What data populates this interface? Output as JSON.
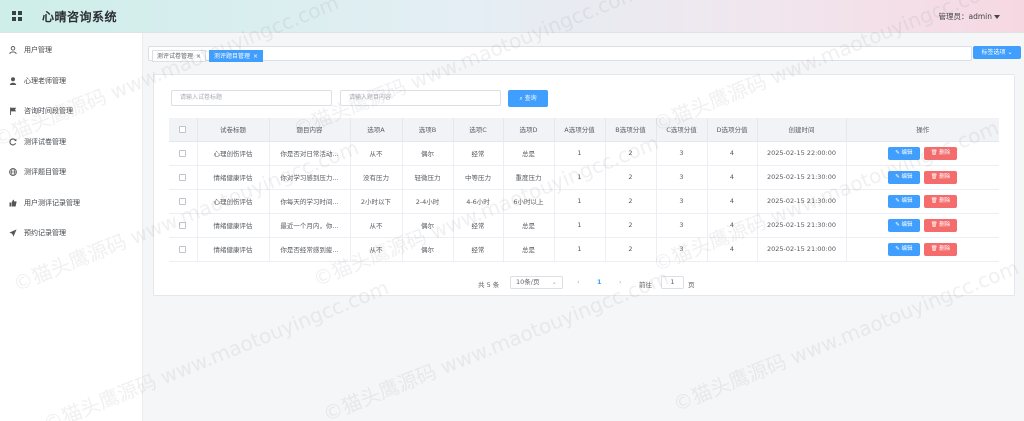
{
  "header": {
    "title": "心晴咨询系统",
    "admin_label": "管理员：admin"
  },
  "sidebar": {
    "items": [
      {
        "label": "用户管理",
        "icon": "user-icon"
      },
      {
        "label": "心理老师管理",
        "icon": "person-icon"
      },
      {
        "label": "咨询时间段管理",
        "icon": "flag-icon"
      },
      {
        "label": "测评试卷管理",
        "icon": "refresh-icon"
      },
      {
        "label": "测评题目管理",
        "icon": "globe-icon"
      },
      {
        "label": "用户测评记录管理",
        "icon": "thumb-icon"
      },
      {
        "label": "预约记录管理",
        "icon": "send-icon"
      }
    ]
  },
  "tabs": [
    {
      "label": "测评试卷管理",
      "active": false
    },
    {
      "label": "测评题目管理",
      "active": true
    }
  ],
  "tab_options_label": "标签选项",
  "filters": {
    "paper_placeholder": "请输入试卷标题",
    "content_placeholder": "请输入题目内容",
    "search_label": "查询"
  },
  "table": {
    "columns": [
      "试卷标题",
      "题目内容",
      "选项A",
      "选项B",
      "选项C",
      "选项D",
      "A选项分值",
      "B选项分值",
      "C选项分值",
      "D选项分值",
      "创建时间",
      "操作"
    ],
    "rows": [
      [
        "心理创伤评估",
        "你是否对日常活动...",
        "从不",
        "偶尔",
        "经常",
        "总是",
        "1",
        "2",
        "3",
        "4",
        "2025-02-15 22:00:00"
      ],
      [
        "情绪健康评估",
        "你对学习感到压力...",
        "没有压力",
        "轻微压力",
        "中等压力",
        "重度压力",
        "1",
        "2",
        "3",
        "4",
        "2025-02-15 21:30:00"
      ],
      [
        "心理创伤评估",
        "你每天的学习时间...",
        "2小时以下",
        "2-4小时",
        "4-6小时",
        "6小时以上",
        "1",
        "2",
        "3",
        "4",
        "2025-02-15 21:30:00"
      ],
      [
        "情绪健康评估",
        "最近一个月内，你...",
        "从不",
        "偶尔",
        "经常",
        "总是",
        "1",
        "2",
        "3",
        "4",
        "2025-02-15 21:30:00"
      ],
      [
        "情绪健康评估",
        "你是否经常感到疲...",
        "从不",
        "偶尔",
        "经常",
        "总是",
        "1",
        "2",
        "3",
        "4",
        "2025-02-15 21:00:00"
      ]
    ],
    "edit_label": "编辑",
    "delete_label": "删除"
  },
  "pagination": {
    "total_label": "共 5 条",
    "page_size": "10条/页",
    "current_page": "1",
    "goto_label": "前往",
    "goto_value": "1",
    "page_unit": "页"
  },
  "watermark": {
    "text_cn": "©猫头鹰源码",
    "text_url": "www.maotouyingcc.com"
  },
  "colors": {
    "primary": "#409eff",
    "danger": "#f56c6c"
  }
}
